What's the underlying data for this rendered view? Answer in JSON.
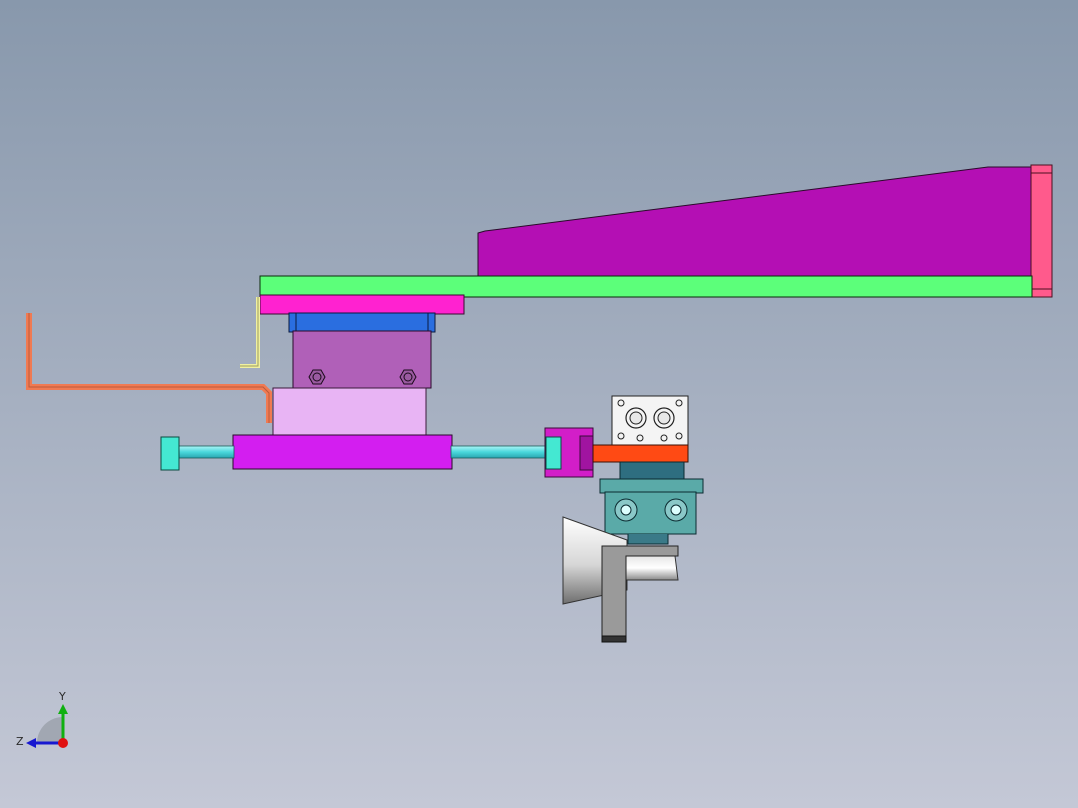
{
  "viewport": {
    "background_top": "#8898ac",
    "background_bottom": "#c4c8d6"
  },
  "triad": {
    "y_label": "Y",
    "z_label": "Z",
    "x_axis_color": "#e01010",
    "y_axis_color": "#10b010",
    "z_axis_color": "#1818d0"
  },
  "parts": [
    {
      "name": "wedge-plate",
      "color": "#b40fb4"
    },
    {
      "name": "end-cap",
      "color": "#ff5a8c"
    },
    {
      "name": "arm-beam",
      "color": "#5cff7a"
    },
    {
      "name": "mounting-plate",
      "color": "#ff22d0"
    },
    {
      "name": "blue-clamp",
      "color": "#2a6ee0"
    },
    {
      "name": "slide-block",
      "color": "#b060b8"
    },
    {
      "name": "lower-block",
      "color": "#e8b4f4"
    },
    {
      "name": "bent-wire",
      "color": "#f07a52"
    },
    {
      "name": "l-bracket",
      "color": "#f0f0a0"
    },
    {
      "name": "carriage",
      "color": "#d31ef0"
    },
    {
      "name": "guide-rod",
      "color": "#5ae6e6"
    },
    {
      "name": "rod-end-stop",
      "color": "#44e8d2"
    },
    {
      "name": "rod-clamp",
      "color": "#d21ec8"
    },
    {
      "name": "white-cylinder",
      "color": "#f4f4f4"
    },
    {
      "name": "orange-plate",
      "color": "#ff4a14"
    },
    {
      "name": "rotary-actuator",
      "color": "#5aaaa8"
    },
    {
      "name": "gripper-body",
      "color": "#9a9a9a"
    },
    {
      "name": "suction-cone",
      "color": "#d0d0d0"
    }
  ]
}
